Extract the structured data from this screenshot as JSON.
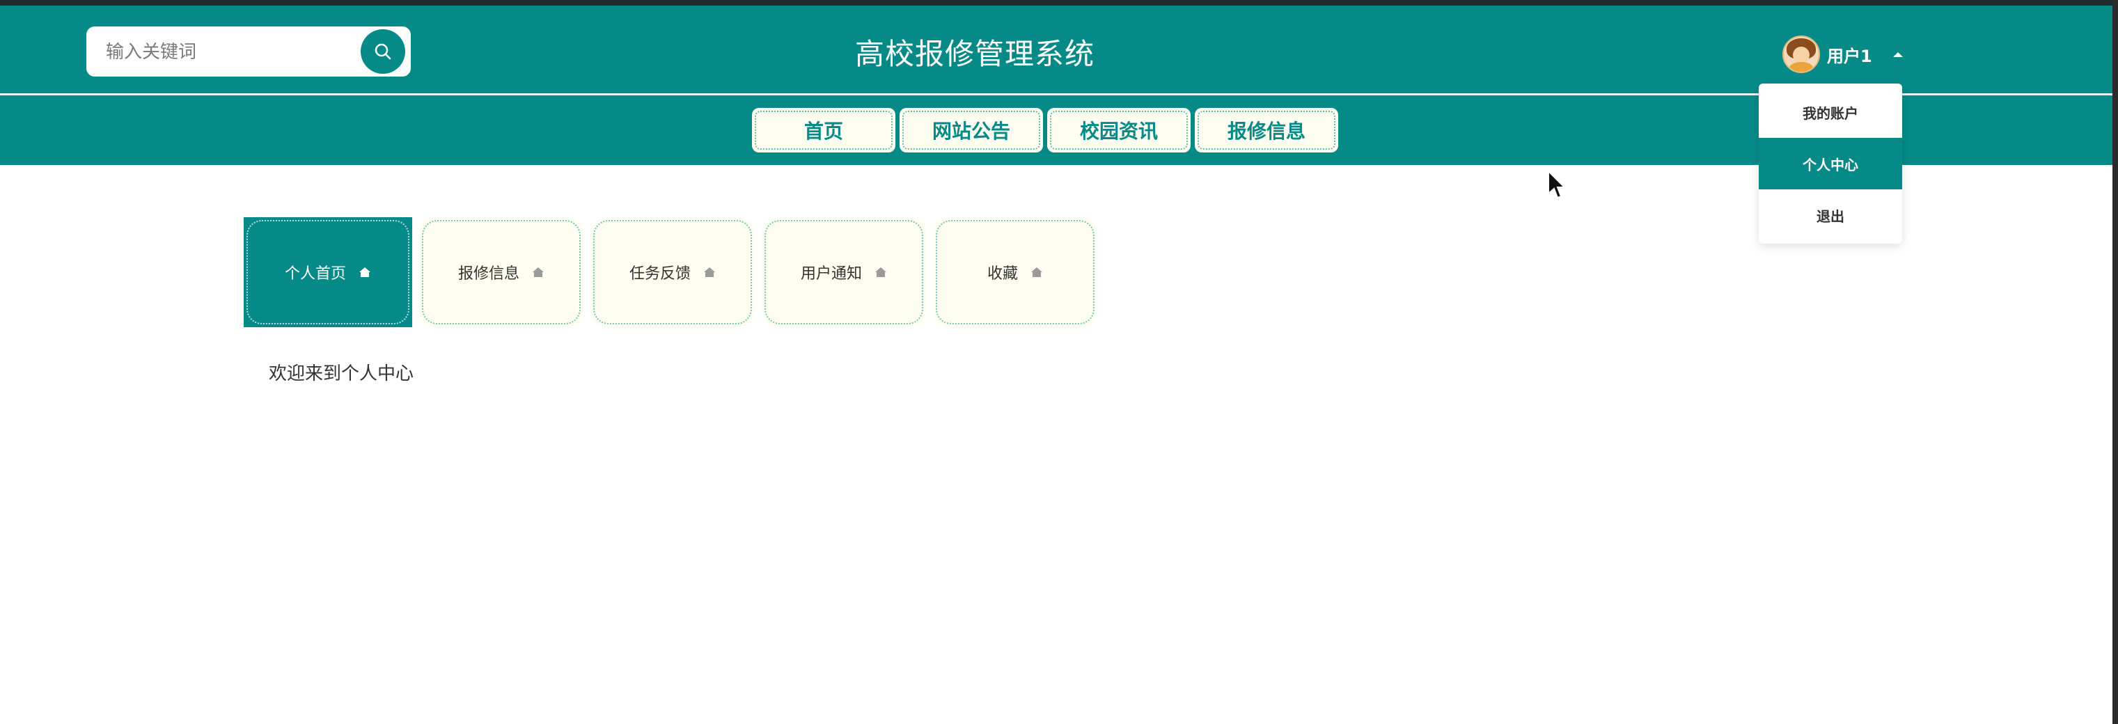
{
  "header": {
    "title": "高校报修管理系统",
    "search": {
      "placeholder": "输入关键词",
      "value": ""
    },
    "user": {
      "name": "用户1"
    }
  },
  "nav": {
    "items": [
      {
        "label": "首页"
      },
      {
        "label": "网站公告"
      },
      {
        "label": "校园资讯"
      },
      {
        "label": "报修信息"
      }
    ]
  },
  "user_menu": {
    "items": [
      {
        "label": "我的账户"
      },
      {
        "label": "个人中心",
        "active": true
      },
      {
        "label": "退出"
      }
    ]
  },
  "profile_tabs": {
    "items": [
      {
        "label": "个人首页",
        "active": true
      },
      {
        "label": "报修信息"
      },
      {
        "label": "任务反馈"
      },
      {
        "label": "用户通知"
      },
      {
        "label": "收藏"
      }
    ]
  },
  "main": {
    "welcome_text": "欢迎来到个人中心"
  },
  "colors": {
    "primary": "#068a88",
    "tab_bg": "#fdfdf0",
    "dotted_border": "#7cc4b8"
  }
}
